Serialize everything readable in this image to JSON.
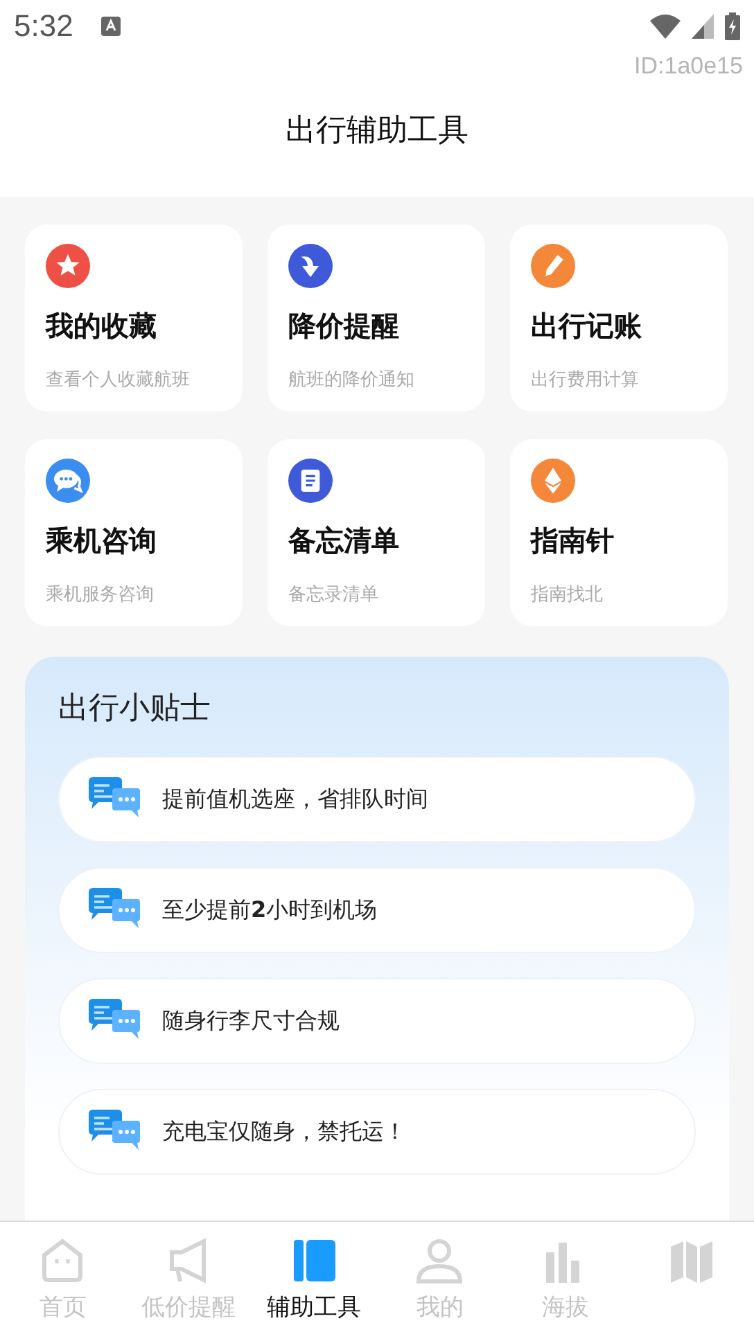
{
  "status_bar": {
    "time": "5:32"
  },
  "user_id": "ID:1a0e15",
  "header": {
    "title": "出行辅助工具"
  },
  "tools": [
    {
      "kind": "star",
      "color": "#ef5046",
      "title": "我的收藏",
      "subtitle": "查看个人收藏航班"
    },
    {
      "kind": "arrow",
      "color": "#3f5ad8",
      "title": "降价提醒",
      "subtitle": "航班的降价通知"
    },
    {
      "kind": "pen",
      "color": "#f5873a",
      "title": "出行记账",
      "subtitle": "出行费用计算"
    },
    {
      "kind": "chat",
      "color": "#3b8ef0",
      "title": "乘机咨询",
      "subtitle": "乘机服务咨询"
    },
    {
      "kind": "note",
      "color": "#3f5ad8",
      "title": "备忘清单",
      "subtitle": "备忘录清单"
    },
    {
      "kind": "diamond",
      "color": "#f5873a",
      "title": "指南针",
      "subtitle": "指南找北"
    }
  ],
  "tips": {
    "title": "出行小贴士",
    "items": [
      "提前值机选座，省排队时间",
      "至少提前**2**小时到机场",
      "随身行李尺寸合规",
      "充电宝仅随身，禁托运！"
    ]
  },
  "nav": [
    {
      "kind": "home",
      "label": "首页",
      "selected": false
    },
    {
      "kind": "megaphone",
      "label": "低价提醒",
      "selected": false
    },
    {
      "kind": "book",
      "label": "辅助工具",
      "selected": true
    },
    {
      "kind": "person",
      "label": "我的",
      "selected": false
    },
    {
      "kind": "bars",
      "label": "海拔",
      "selected": false
    },
    {
      "kind": "map",
      "selected": false
    }
  ]
}
